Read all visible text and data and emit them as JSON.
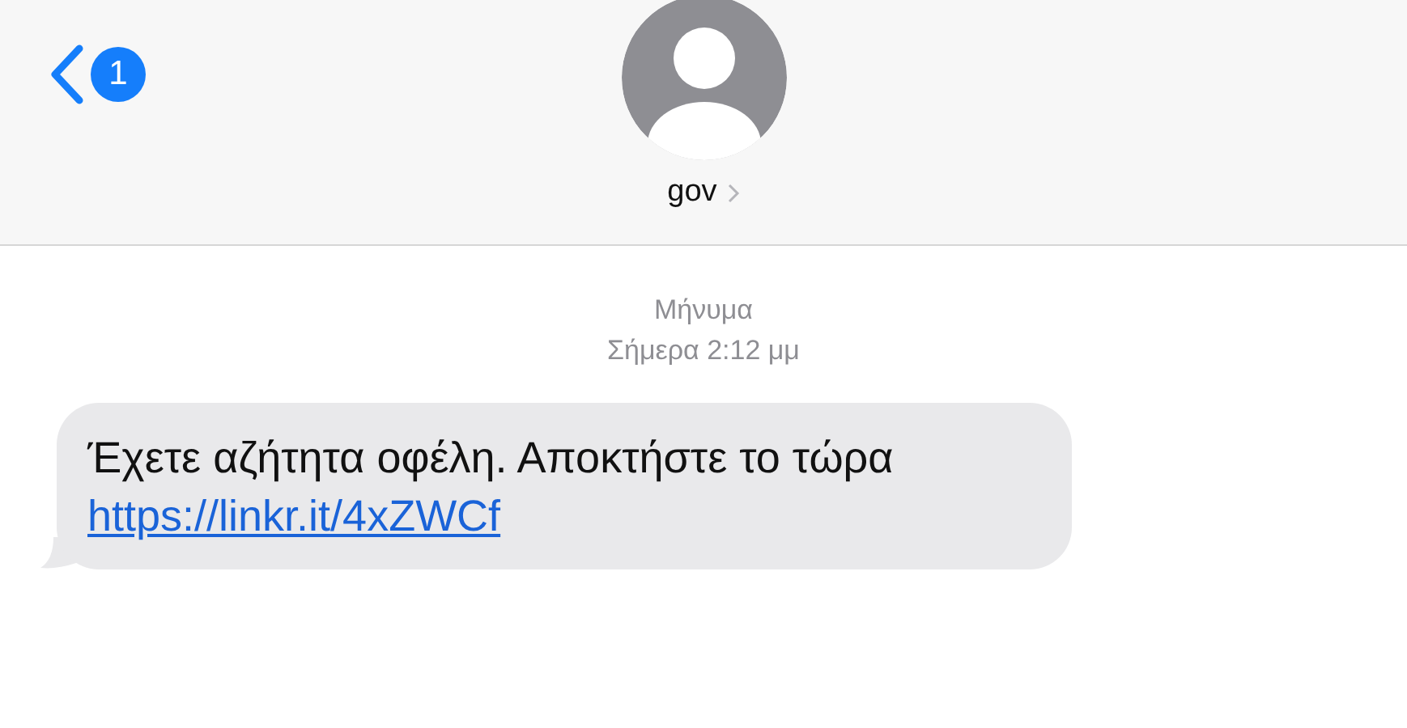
{
  "header": {
    "back_badge": "1",
    "contact_name": "gov"
  },
  "conversation": {
    "service": "Μήνυμα",
    "timestamp": "Σήμερα 2:12 μμ",
    "messages": [
      {
        "kind": "incoming",
        "text": "Έχετε αζήτητα οφέλη. Αποκτήστε το τώρα",
        "link": "https://linkr.it/4xZWCf"
      }
    ]
  }
}
